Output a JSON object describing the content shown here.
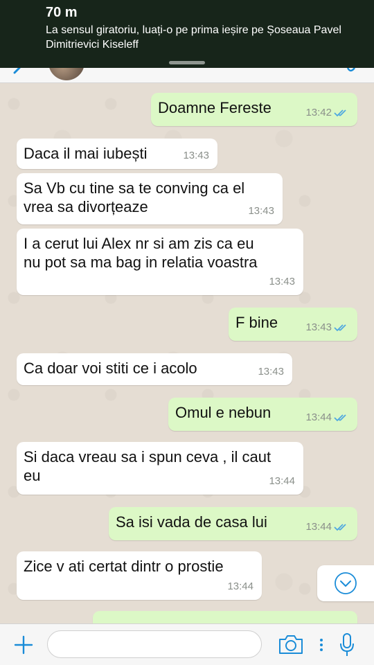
{
  "navigation": {
    "distance": "70 m",
    "instruction": "La sensul giratoriu, luați-o pe prima ieșire pe Șoseaua Pavel Dimitrievici Kiseleff"
  },
  "messages": [
    {
      "dir": "out",
      "text": "Doamne Fereste",
      "time": "13:42",
      "read": true
    },
    {
      "dir": "in",
      "text": "Daca il mai iubești",
      "time": "13:43"
    },
    {
      "dir": "in",
      "lines": [
        "Sa Vb cu tine sa te conving ca el",
        "vrea sa divorțeaze"
      ],
      "time": "13:43"
    },
    {
      "dir": "in",
      "lines": [
        "I a cerut lui Alex nr si am zis ca eu",
        "nu pot sa ma bag in relatia voastra"
      ],
      "time": "13:43"
    },
    {
      "dir": "out",
      "text": "F bine",
      "time": "13:43",
      "read": true
    },
    {
      "dir": "in",
      "text": "Ca doar voi stiti ce i acolo",
      "time": "13:43"
    },
    {
      "dir": "out",
      "text": "Omul e nebun",
      "time": "13:44",
      "read": true
    },
    {
      "dir": "in",
      "lines": [
        "Si daca vreau sa i spun ceva , il caut",
        "eu"
      ],
      "time": "13:44"
    },
    {
      "dir": "out",
      "text": "Sa isi vada de casa lui",
      "time": "13:44",
      "read": true
    },
    {
      "dir": "in",
      "text": "Zice v ati certat dintr o prostie",
      "time": "13:44"
    }
  ],
  "input": {
    "placeholder": ""
  },
  "icons": {
    "plus": "plus-icon",
    "camera": "camera-icon",
    "mic": "microphone-icon",
    "scroll": "chevron-down-icon",
    "read": "double-check-icon"
  },
  "colors": {
    "outgoing_bubble": "#dcf8c6",
    "incoming_bubble": "#ffffff",
    "accent": "#1a8cd8",
    "read_ticks": "#4fa8e0",
    "nav_banner": "#17251a"
  }
}
